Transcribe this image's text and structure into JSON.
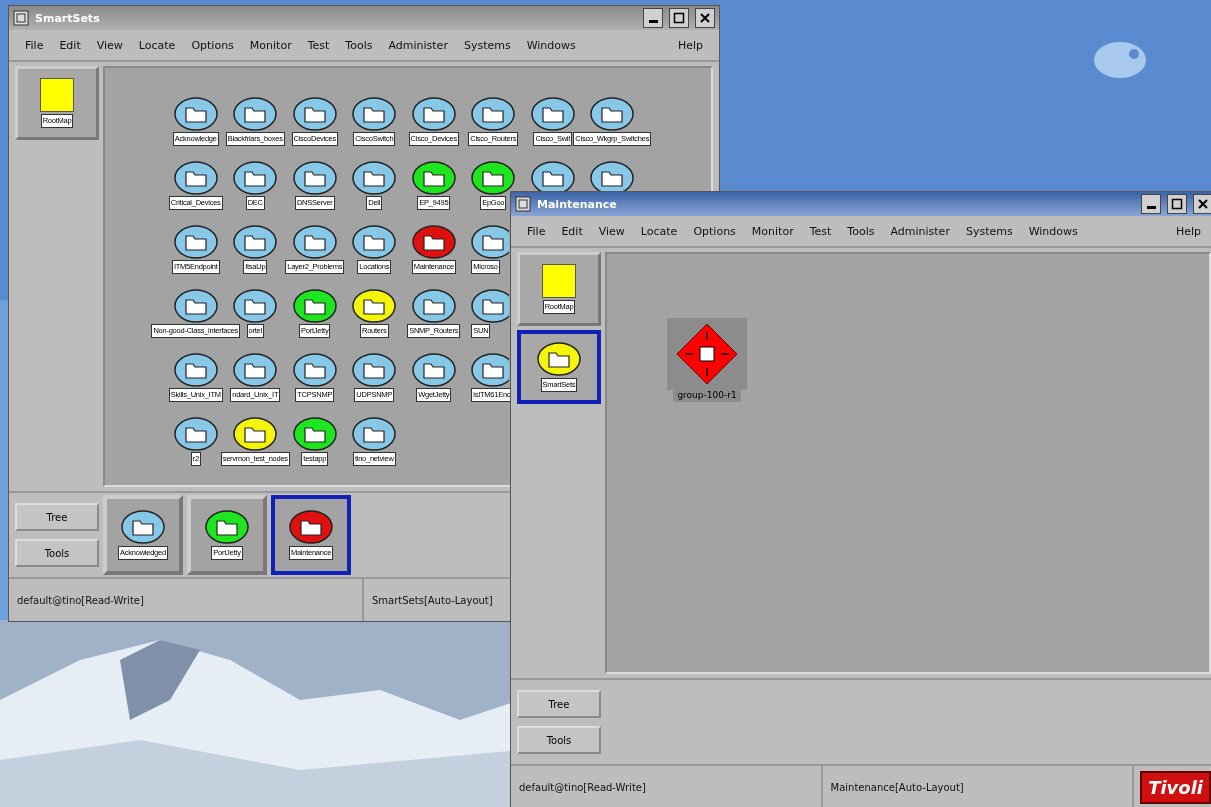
{
  "windows": [
    {
      "title": "SmartSets",
      "menu": [
        "File",
        "Edit",
        "View",
        "Locate",
        "Options",
        "Monitor",
        "Test",
        "Tools",
        "Administer",
        "Systems",
        "Windows"
      ],
      "help": "Help",
      "side": [
        {
          "label": "RootMap",
          "kind": "square",
          "color": "#ffff00",
          "selected": false
        }
      ],
      "map": {
        "kind": "folders",
        "rows": [
          [
            {
              "label": "Acknowledge",
              "color": "#87c8e8"
            },
            {
              "label": "Blackfriars_boxes",
              "color": "#87c8e8"
            },
            {
              "label": "CiscoDevices",
              "color": "#87c8e8"
            },
            {
              "label": "CiscoSwitch",
              "color": "#87c8e8"
            },
            {
              "label": "Cisco_Devices",
              "color": "#87c8e8"
            },
            {
              "label": "Cisco_Routers",
              "color": "#87c8e8"
            },
            {
              "label": "Cisco_Swit",
              "color": "#87c8e8"
            },
            {
              "label": "Cisco_Wkgrp_Switches",
              "color": "#87c8e8"
            }
          ],
          [
            {
              "label": "Critical_Devices",
              "color": "#87c8e8"
            },
            {
              "label": "DEC",
              "color": "#87c8e8"
            },
            {
              "label": "DNSServer",
              "color": "#87c8e8"
            },
            {
              "label": "Dell",
              "color": "#87c8e8"
            },
            {
              "label": "EP_9495",
              "color": "#1ee61e"
            },
            {
              "label": "EpGoo",
              "color": "#1ee61e"
            },
            {
              "color": "#87c8e8"
            },
            {
              "color": "#87c8e8"
            }
          ],
          [
            {
              "label": "ITM5Endpoint",
              "color": "#87c8e8"
            },
            {
              "label": "ItsaUp",
              "color": "#87c8e8"
            },
            {
              "label": "Layer2_Problems",
              "color": "#87c8e8"
            },
            {
              "label": "Locations",
              "color": "#87c8e8"
            },
            {
              "label": "Maintenance",
              "color": "#e01010"
            },
            {
              "label": "Microso",
              "color": "#87c8e8"
            }
          ],
          [
            {
              "label": "Non-good-Class_interfaces",
              "color": "#87c8e8"
            },
            {
              "label": "ortel",
              "color": "#87c8e8"
            },
            {
              "label": "PortJetty",
              "color": "#1ee61e"
            },
            {
              "label": "Routers",
              "color": "#f5f50a"
            },
            {
              "label": "SNMP_Routers",
              "color": "#87c8e8"
            },
            {
              "label": "SUN",
              "color": "#87c8e8"
            }
          ],
          [
            {
              "label": "Skills_Unix_ITM",
              "color": "#87c8e8"
            },
            {
              "label": "ndard_Unix_IT",
              "color": "#87c8e8"
            },
            {
              "label": "TCPSNMP",
              "color": "#87c8e8"
            },
            {
              "label": "UDPSNMP",
              "color": "#87c8e8"
            },
            {
              "label": "WgetJetty",
              "color": "#87c8e8"
            },
            {
              "label": "isITM61Enc",
              "color": "#87c8e8"
            }
          ],
          [
            {
              "label": "r2",
              "color": "#87c8e8"
            },
            {
              "label": "servmon_test_nodes",
              "color": "#f5f50a"
            },
            {
              "label": "testapp",
              "color": "#1ee61e"
            },
            {
              "label": "tino_netview",
              "color": "#87c8e8"
            }
          ]
        ]
      },
      "buttons": [
        "Tree",
        "Tools"
      ],
      "shelf": [
        {
          "label": "Acknowledged",
          "color": "#87c8e8",
          "selected": false
        },
        {
          "label": "PortJetty",
          "color": "#1ee61e",
          "selected": false
        },
        {
          "label": "Maintenance",
          "color": "#e01010",
          "selected": true
        }
      ],
      "status": [
        "default@tino[Read-Write]",
        "SmartSets[Auto-Layout]"
      ]
    },
    {
      "title": "Maintenance",
      "menu": [
        "File",
        "Edit",
        "View",
        "Locate",
        "Options",
        "Monitor",
        "Test",
        "Tools",
        "Administer",
        "Systems",
        "Windows"
      ],
      "help": "Help",
      "side": [
        {
          "label": "RootMap",
          "kind": "square",
          "color": "#ffff00",
          "selected": false
        },
        {
          "label": "SmartSets",
          "kind": "folder",
          "color": "#f5f50a",
          "selected": true
        }
      ],
      "map": {
        "kind": "nodes",
        "nodes": [
          {
            "label": "group-100-r1",
            "color": "#ff0000"
          }
        ]
      },
      "buttons": [
        "Tree",
        "Tools"
      ],
      "status": [
        "default@tino[Read-Write]",
        "Maintenance[Auto-Layout]"
      ],
      "brand": "Tivoli"
    }
  ]
}
